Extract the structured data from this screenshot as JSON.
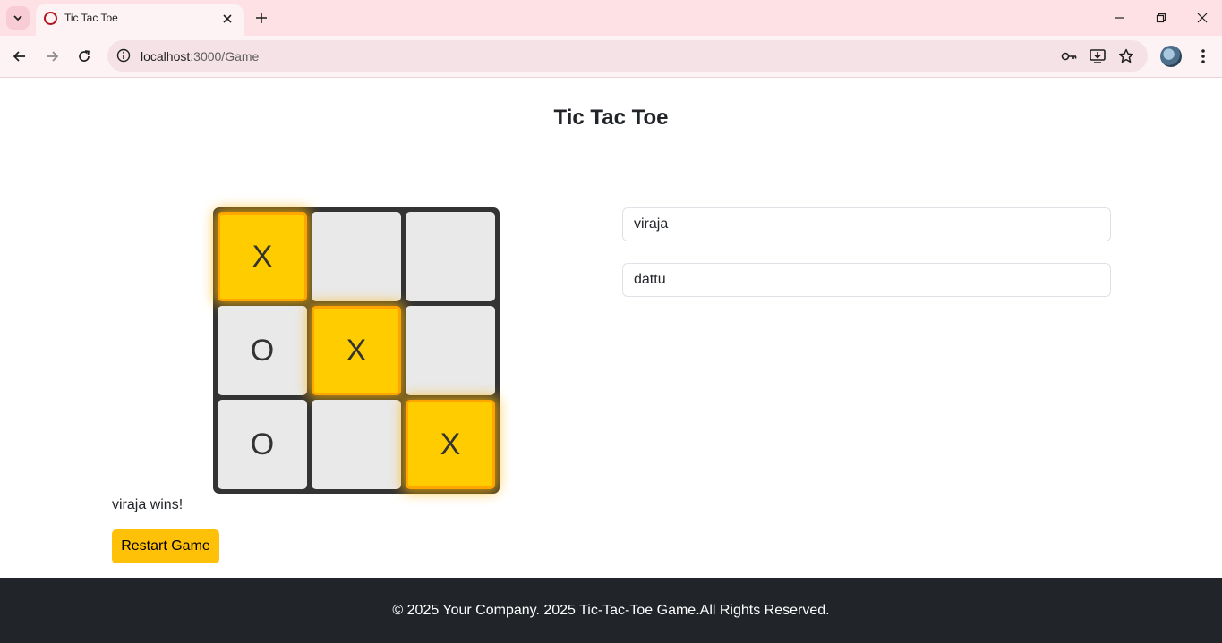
{
  "browser": {
    "tab": {
      "title": "Tic Tac Toe"
    },
    "url": {
      "host": "localhost",
      "path": ":3000/Game"
    }
  },
  "game": {
    "title": "Tic Tac Toe",
    "cells": [
      {
        "mark": "X",
        "winning": true
      },
      {
        "mark": "",
        "winning": false
      },
      {
        "mark": "",
        "winning": false
      },
      {
        "mark": "O",
        "winning": false
      },
      {
        "mark": "X",
        "winning": true
      },
      {
        "mark": "",
        "winning": false
      },
      {
        "mark": "O",
        "winning": false
      },
      {
        "mark": "",
        "winning": false
      },
      {
        "mark": "X",
        "winning": true
      }
    ],
    "status": "viraja wins!",
    "restart_label": "Restart Game",
    "player1_value": "viraja",
    "player2_value": "dattu"
  },
  "colors": {
    "win_cell": "#ffcc00",
    "empty_cell": "#e9e9e9",
    "board": "#333333",
    "button": "#ffc107",
    "footer": "#212529"
  },
  "footer": {
    "text": "© 2025 Your Company. 2025 Tic-Tac-Toe Game.All Rights Reserved."
  }
}
